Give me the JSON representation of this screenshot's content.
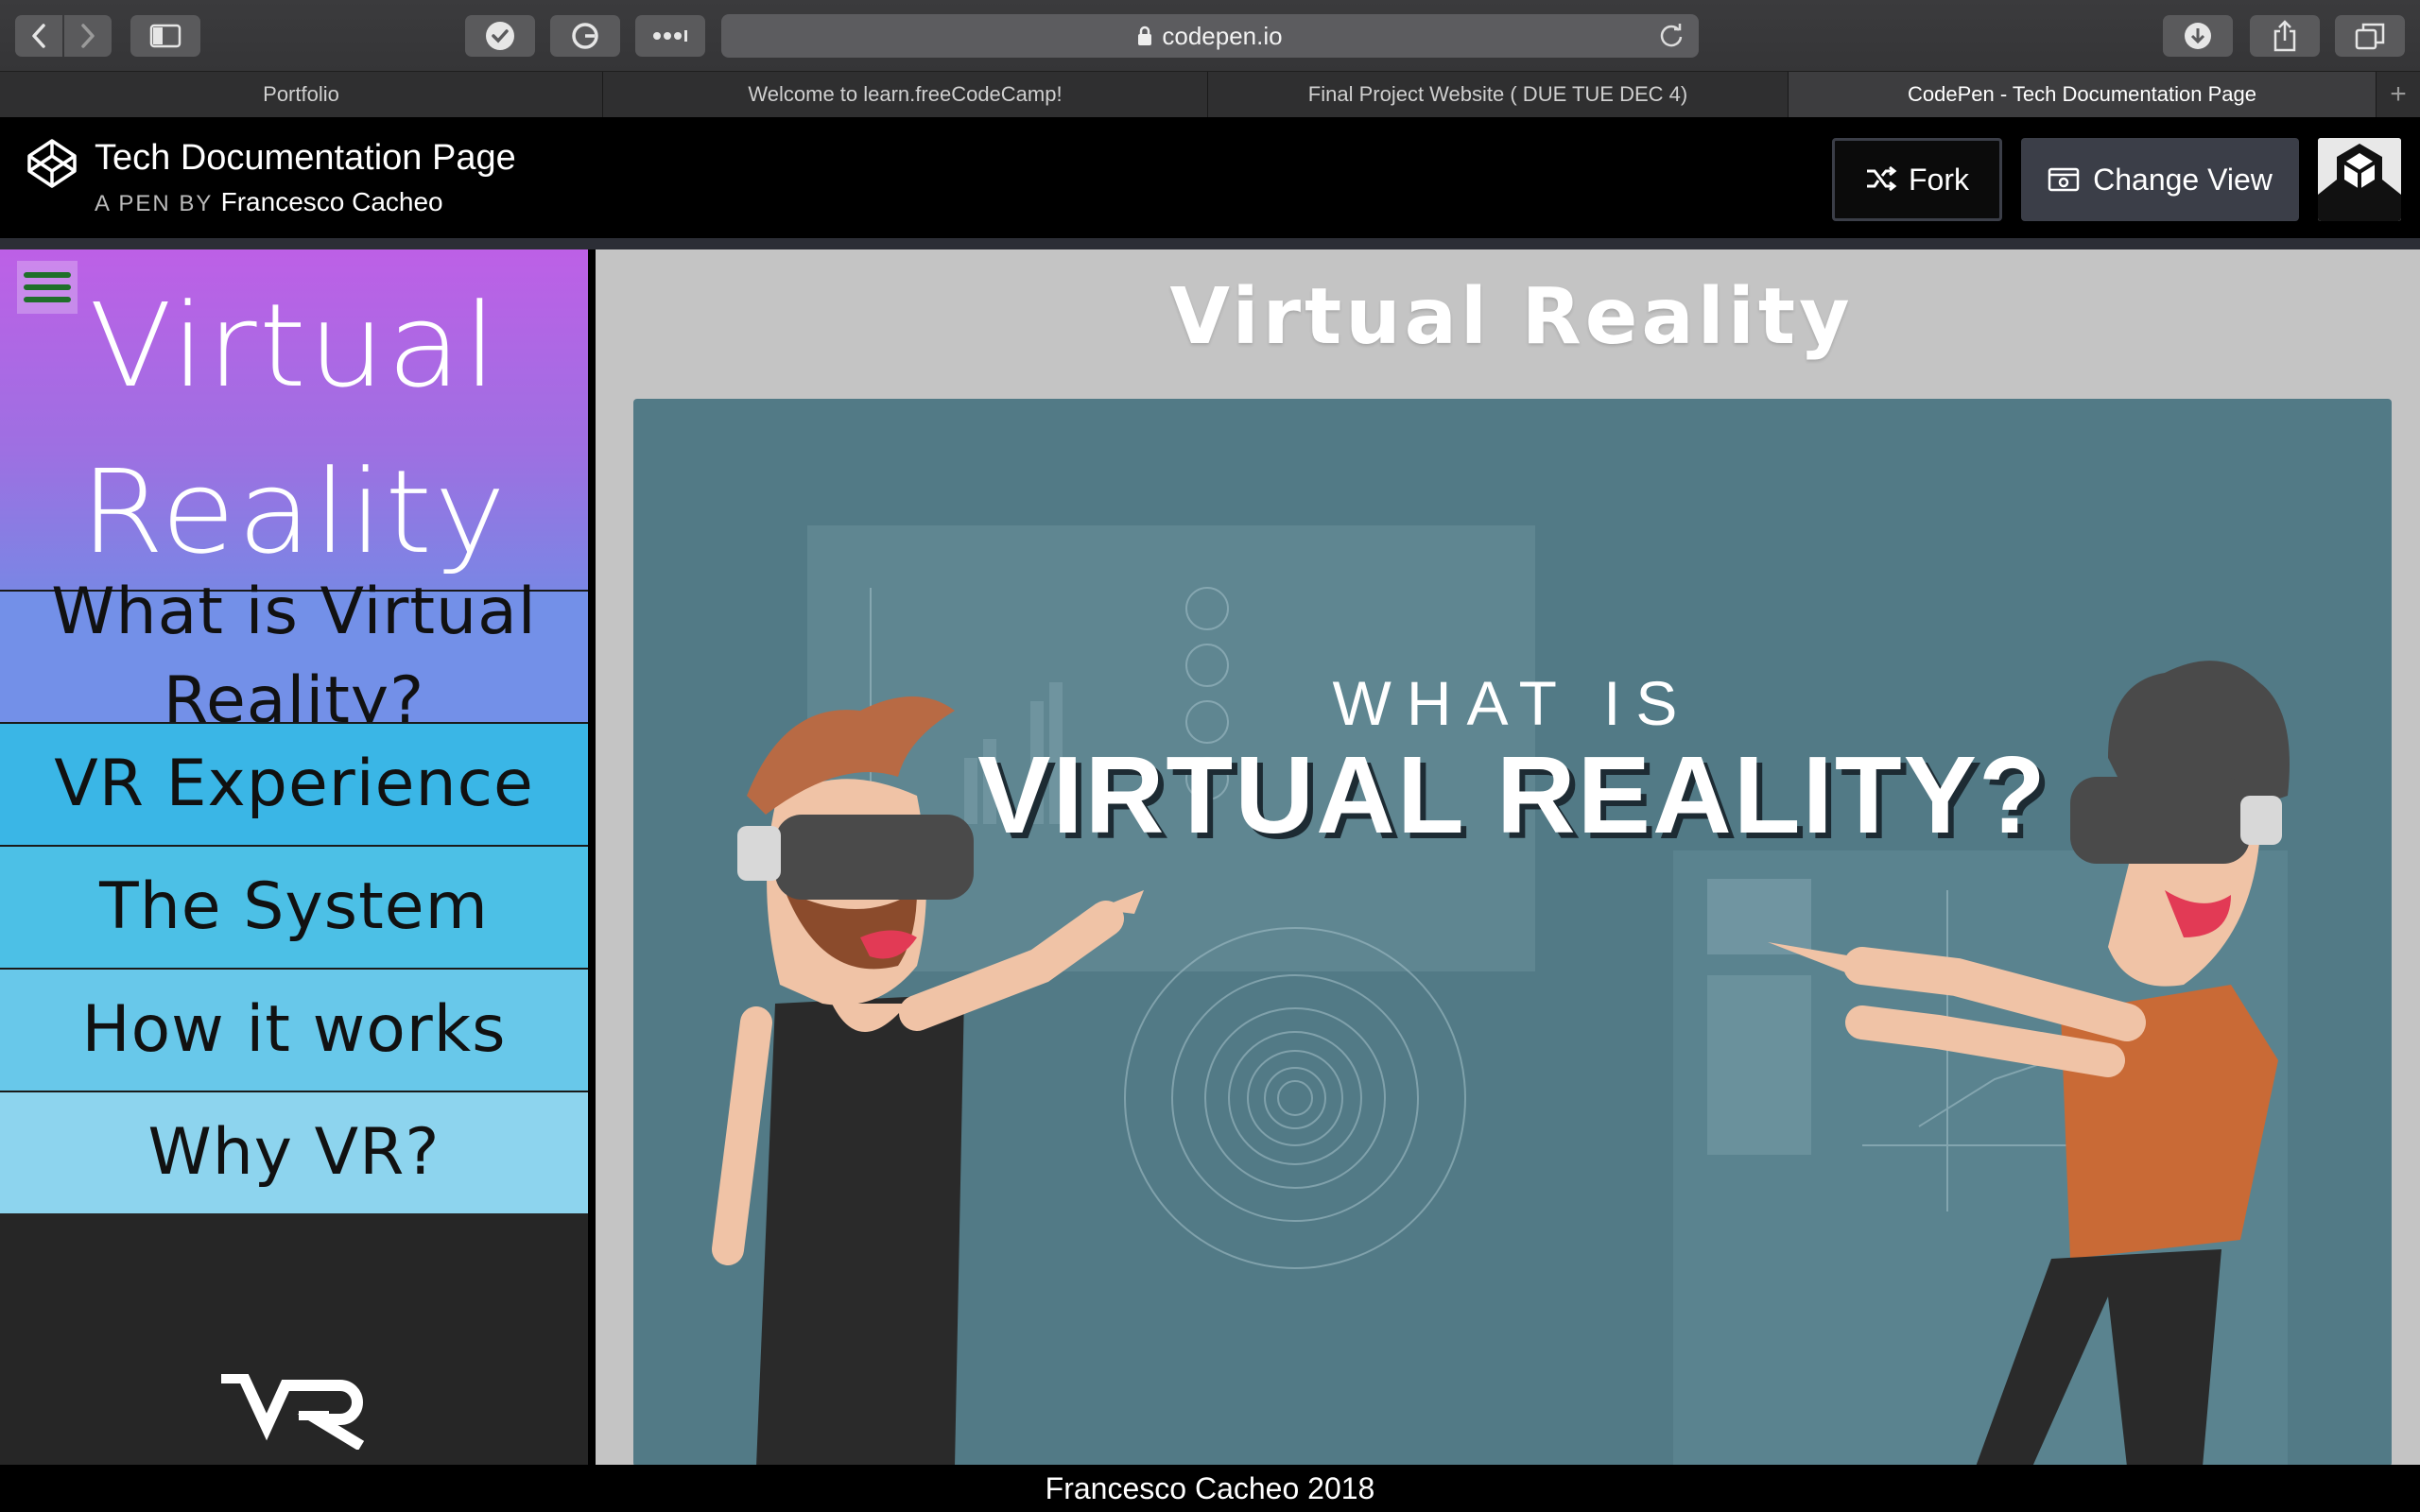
{
  "browser": {
    "address": "codepen.io",
    "tabs": [
      {
        "label": "Portfolio",
        "active": false
      },
      {
        "label": "Welcome to learn.freeCodeCamp!",
        "active": false
      },
      {
        "label": "Final Project Website ( DUE TUE DEC 4)",
        "active": false
      },
      {
        "label": "CodePen - Tech Documentation Page",
        "active": true
      }
    ],
    "new_tab": "+"
  },
  "pen": {
    "title": "Tech Documentation Page",
    "byline": "A PEN BY",
    "author": "Francesco Cacheo",
    "fork_label": "Fork",
    "change_view_label": "Change View"
  },
  "nav": {
    "title": "Virtual Reality",
    "links": [
      {
        "label": "What is Virtual Reality?",
        "color": "#7390e8"
      },
      {
        "label": "VR Experience",
        "color": "#3ab6e6"
      },
      {
        "label": "The System",
        "color": "#4cc0e6"
      },
      {
        "label": "How it works",
        "color": "#68c8ea"
      },
      {
        "label": "Why VR?",
        "color": "#8dd4ee"
      }
    ],
    "logo_text": "VR"
  },
  "main": {
    "title": "Virtual Reality",
    "hero": {
      "line1": "WHAT IS",
      "line2": "VIRTUAL REALITY?"
    }
  },
  "footer": {
    "text": "Francesco Cacheo 2018"
  },
  "colors": {
    "nav_head_top": "#bd60e6",
    "nav_head_bottom": "#7a86e4",
    "hero_bg": "#527a86",
    "content_bg": "#c4c4c4"
  }
}
